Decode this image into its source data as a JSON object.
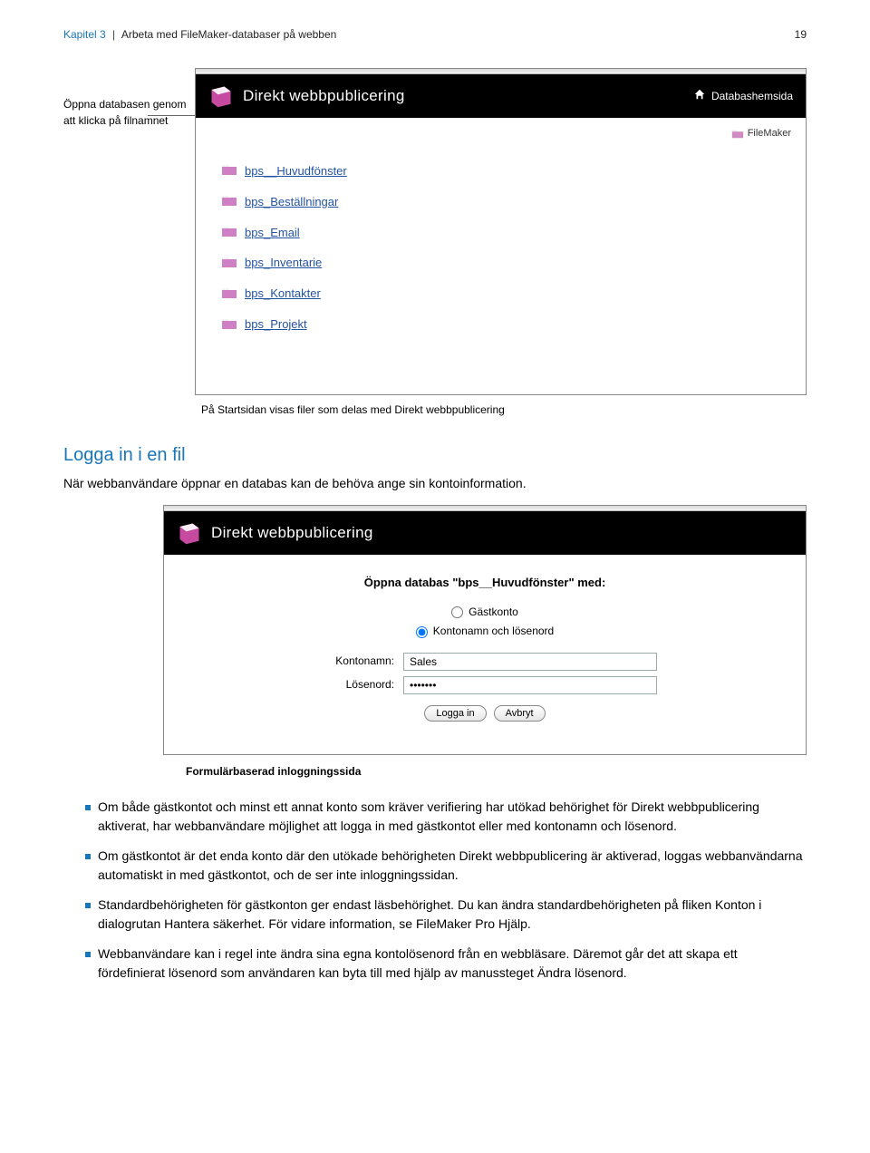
{
  "header": {
    "chapter": "Kapitel 3",
    "title": "Arbeta med FileMaker-databaser på webben",
    "page": "19"
  },
  "annotation1": "Öppna databasen genom att klicka på filnamnet",
  "brand_title": "Direkt webbpublicering",
  "home_link": "Databashemsida",
  "server_brand": "FileMaker",
  "databases": [
    {
      "name": "bps__Huvudfönster"
    },
    {
      "name": "bps_Beställningar"
    },
    {
      "name": "bps_Email"
    },
    {
      "name": "bps_Inventarie"
    },
    {
      "name": "bps_Kontakter"
    },
    {
      "name": "bps_Projekt"
    }
  ],
  "caption1": "På Startsidan visas filer som delas med Direkt webbpublicering",
  "section_heading": "Logga in i en fil",
  "section_intro": "När webbanvändare öppnar en databas kan de behöva ange sin kontoinformation.",
  "login": {
    "title": "Öppna databas \"bps__Huvudfönster\" med:",
    "radio_guest": "Gästkonto",
    "radio_account": "Kontonamn och lösenord",
    "label_user": "Kontonamn:",
    "label_pass": "Lösenord:",
    "value_user": "Sales",
    "value_pass": "•••••••",
    "btn_login": "Logga in",
    "btn_cancel": "Avbryt"
  },
  "caption2": "Formulärbaserad inloggningssida",
  "bullets": [
    "Om både gästkontot och minst ett annat konto som kräver verifiering har utökad behörighet för Direkt webbpublicering aktiverat, har webbanvändare möjlighet att logga in med gästkontot eller med kontonamn och lösenord.",
    "Om gästkontot är det enda konto där den utökade behörigheten Direkt webbpublicering är aktiverad, loggas webbanvändarna automatiskt in med gästkontot, och de ser inte inloggningssidan.",
    "Standardbehörigheten för gästkonton ger endast läsbehörighet. Du kan ändra standardbehörigheten på fliken Konton i dialogrutan Hantera säkerhet. För vidare information, se FileMaker Pro Hjälp.",
    "Webbanvändare kan i regel inte ändra sina egna kontolösenord från en webbläsare. Däremot går det att skapa ett fördefinierat lösenord som användaren kan byta till med hjälp av manussteget Ändra lösenord."
  ]
}
